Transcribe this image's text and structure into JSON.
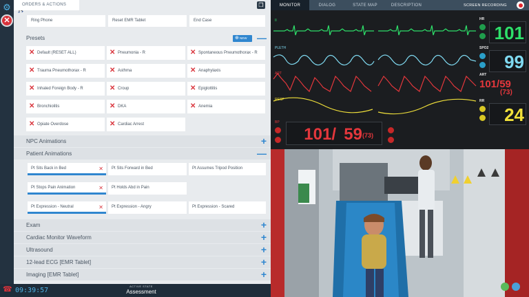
{
  "left_tab": "ORDERS & ACTIONS",
  "orders": [
    "Ring Phone",
    "Reset EMR Tablet",
    "End Case"
  ],
  "presets": {
    "title": "Presets",
    "new_label": "NEW",
    "items": [
      "Default (RESET ALL)",
      "Pneumonia - R",
      "Spontaneous Pneumothorax - R",
      "Trauma Pneumothorax - R",
      "Asthma",
      "Anaphylaxis",
      "Inhaled Foreign Body - R",
      "Croup",
      "Epiglottitis",
      "Bronchiolitis",
      "DKA",
      "Anemia",
      "Opiate Overdose",
      "Cardiac Arrest"
    ]
  },
  "sections": {
    "npc": "NPC Animations",
    "patient": "Patient Animations",
    "exam": "Exam",
    "waveform": "Cardiac Monitor Waveform",
    "ultrasound": "Ultrasound",
    "ecg": "12-lead ECG [EMR Tablet]",
    "imaging": "Imaging [EMR Tablet]"
  },
  "patient_animations": [
    {
      "label": "Pt Sits Back in Bed",
      "active": true
    },
    {
      "label": "Pt Sits Forward in Bed",
      "active": false
    },
    {
      "label": "Pt Assumes Tripod Position",
      "active": false
    },
    {
      "label": "Pt Stops Pain Animation",
      "active": true
    },
    {
      "label": "Pt Holds Abd in Pain",
      "active": false
    },
    {
      "label": "Pt Expression - Neutral",
      "active": true
    },
    {
      "label": "Pt Expression - Angry",
      "active": false
    },
    {
      "label": "Pt Expression - Scared",
      "active": false
    }
  ],
  "bottom": {
    "timer": "09:39:57",
    "state_label": "ACTIVE STATE",
    "state": "Assessment"
  },
  "monitor_tabs": [
    "MONITOR",
    "DIALOG",
    "STATE MAP",
    "DESCRIPTION"
  ],
  "screen_recording": "SCREEN RECORDING",
  "waveforms": {
    "ecg_label": "II",
    "pleth_label": "PLETH",
    "art_label": "ART",
    "resp_label": "RESP",
    "bp_label": "BP"
  },
  "vitals": {
    "hr": {
      "label": "HR",
      "value": "101",
      "color": "#2ee06a"
    },
    "spo2": {
      "label": "SPO2",
      "value": "99",
      "color": "#7fd9f0"
    },
    "art": {
      "label": "ART",
      "value": "101/59",
      "map": "(73)",
      "color": "#e4373c"
    },
    "rr": {
      "label": "RR",
      "value": "24",
      "color": "#f0e03a"
    },
    "nibp_sys": "101/",
    "nibp_dia": "59",
    "nibp_map": "(73)"
  },
  "colors": {
    "accent": "#2f86cf",
    "alert": "#d9363e",
    "ecg": "#2ee06a",
    "pleth": "#7fd9f0",
    "art": "#e4373c",
    "resp": "#f0e03a"
  }
}
